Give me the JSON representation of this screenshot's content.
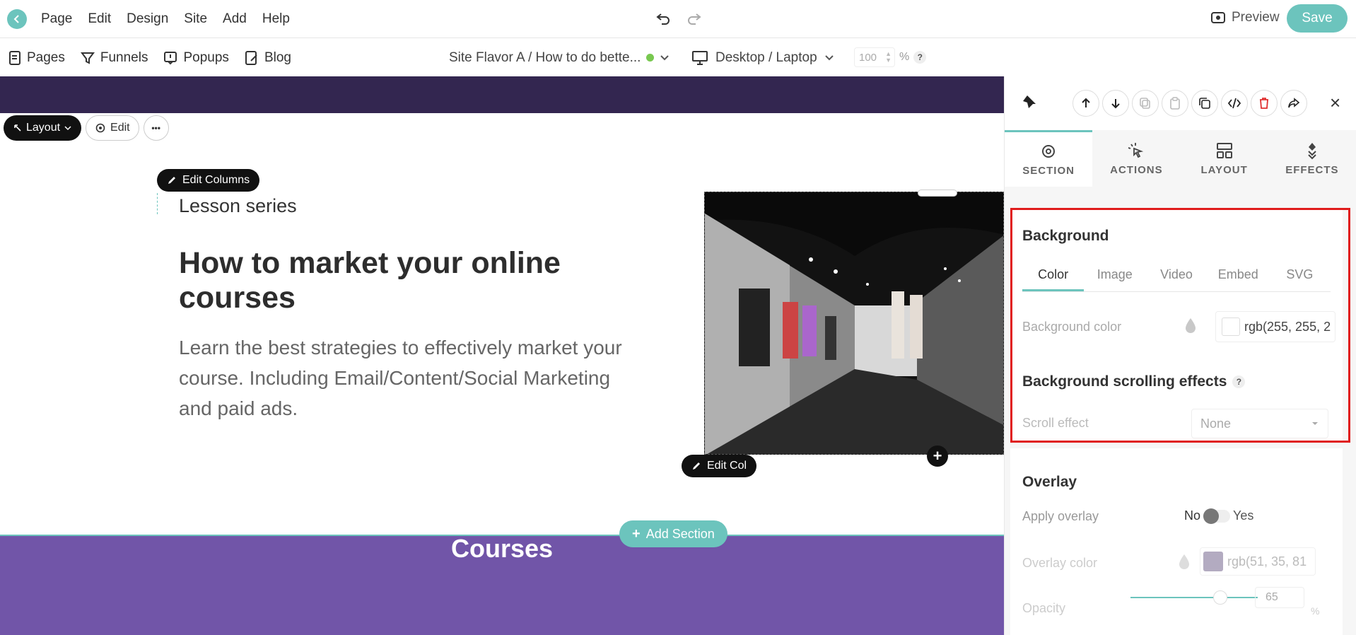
{
  "topbar": {
    "menu": [
      "Page",
      "Edit",
      "Design",
      "Site",
      "Add",
      "Help"
    ],
    "preview_label": "Preview",
    "save_label": "Save"
  },
  "subbar": {
    "nav": [
      "Pages",
      "Funnels",
      "Popups",
      "Blog"
    ],
    "site_flavor": "Site Flavor A / How to do bette...",
    "device": "Desktop / Laptop",
    "zoom_value": "100",
    "zoom_unit": "%",
    "help": "?"
  },
  "canvas": {
    "layout_label": "Layout",
    "edit_label": "Edit",
    "more_label": "•••",
    "edit_columns_label": "Edit Columns",
    "subtitle": "Lesson series",
    "title": "How to market your online courses",
    "description": "Learn the best strategies to effectively market your course. Including Email/Content/Social Marketing and paid ads.",
    "edit_col_label": "Edit Col",
    "add_section_label": "Add Section",
    "courses_title": "Courses",
    "colors": {
      "dark_band": "#332650",
      "purple": "#7155a8",
      "accent": "#6cc4bd"
    }
  },
  "panel": {
    "tabs": [
      {
        "label": "SECTION",
        "icon": "gear-icon"
      },
      {
        "label": "ACTIONS",
        "icon": "cursor-click-icon"
      },
      {
        "label": "LAYOUT",
        "icon": "layout-icon"
      },
      {
        "label": "EFFECTS",
        "icon": "effects-icon"
      }
    ],
    "background": {
      "title": "Background",
      "tabs": [
        "Color",
        "Image",
        "Video",
        "Embed",
        "SVG"
      ],
      "color_label": "Background color",
      "color_value": "rgb(255, 255, 2",
      "scroll_title": "Background scrolling effects",
      "scroll_label": "Scroll effect",
      "scroll_value": "None"
    },
    "overlay": {
      "title": "Overlay",
      "apply_label": "Apply overlay",
      "no": "No",
      "yes": "Yes",
      "color_label": "Overlay color",
      "color_value": "rgb(51, 35, 81",
      "opacity_label": "Opacity",
      "opacity_value": "65",
      "opacity_unit": "%"
    }
  }
}
